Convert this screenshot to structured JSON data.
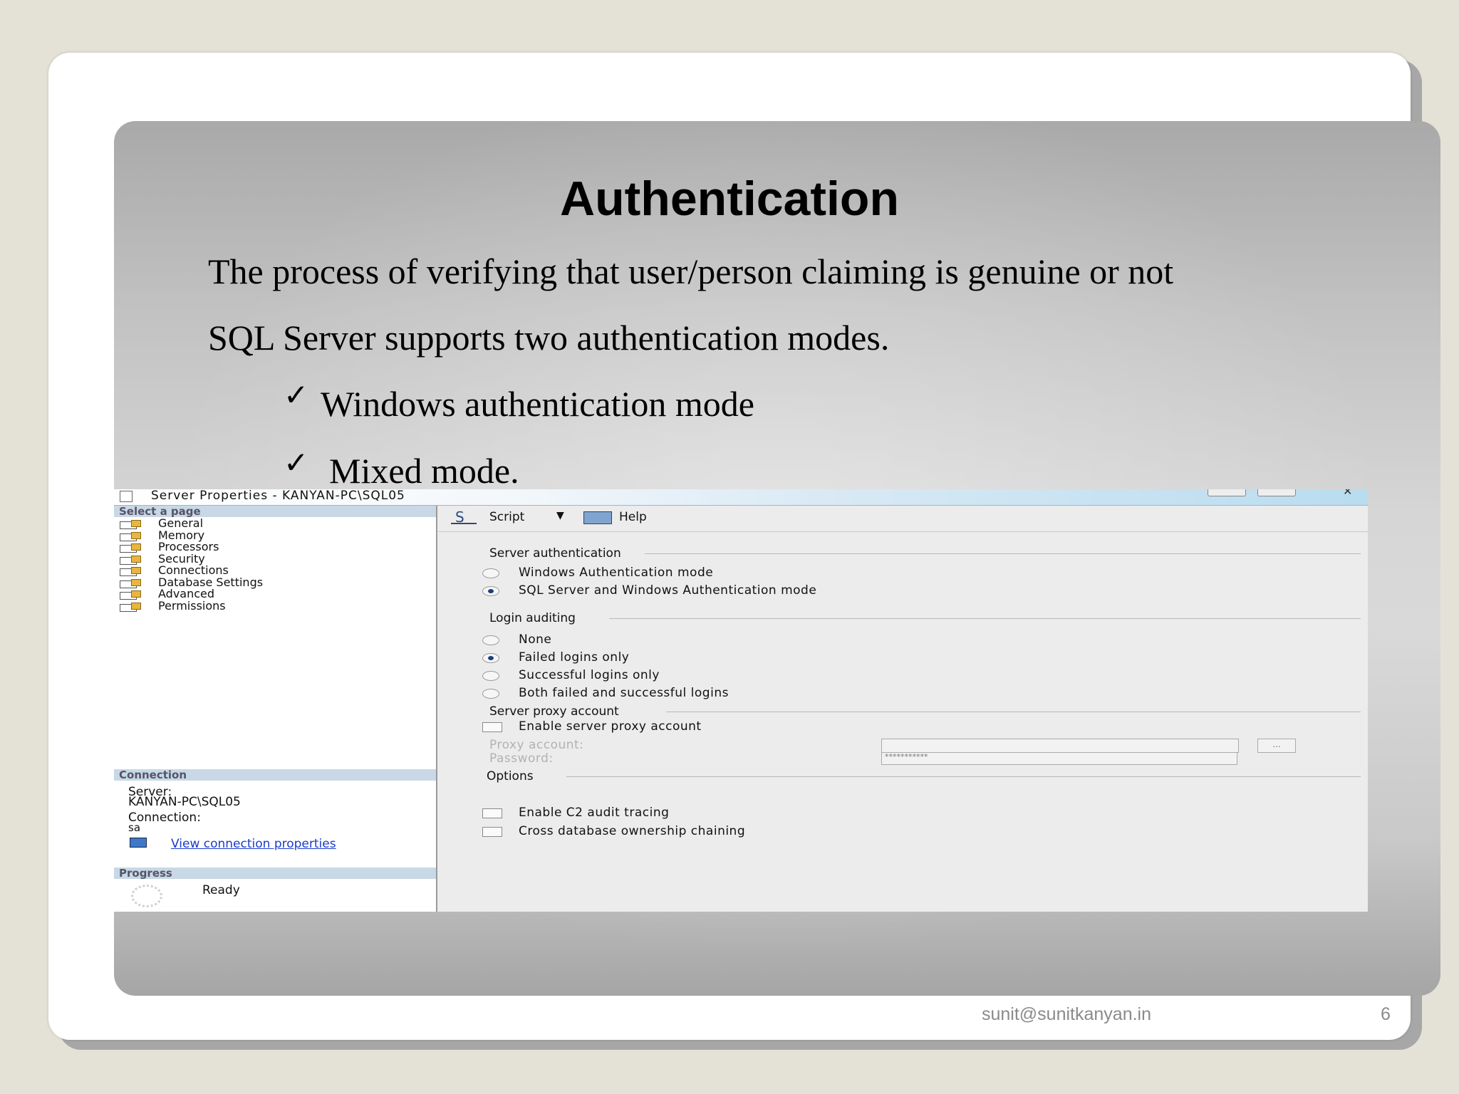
{
  "slide": {
    "title": "Authentication",
    "line1": "The process of verifying that user/person claiming is genuine or not",
    "line2": "SQL Server supports two authentication modes.",
    "bullets": [
      "Windows authentication mode",
      "Mixed mode."
    ],
    "check_glyph": "✓",
    "footer_email": "sunit@sunitkanyan.in",
    "page_number": "6"
  },
  "dialog": {
    "title": "Server Properties - KANYAN-PC\\SQL05",
    "select_page_header": "Select a page",
    "pages": [
      "General",
      "Memory",
      "Processors",
      "Security",
      "Connections",
      "Database Settings",
      "Advanced",
      "Permissions"
    ],
    "connection_header": "Connection",
    "server_label": "Server:",
    "server_value": "KANYAN-PC\\SQL05",
    "connection_label": "Connection:",
    "connection_value": "sa",
    "view_connection_link": "View connection properties",
    "progress_header": "Progress",
    "progress_status": "Ready",
    "toolbar": {
      "script_label": "Script",
      "help_label": "Help"
    },
    "server_auth": {
      "heading": "Server authentication",
      "options": [
        "Windows Authentication mode",
        "SQL Server and Windows Authentication mode"
      ],
      "selected": 1
    },
    "login_auditing": {
      "heading": "Login auditing",
      "options": [
        "None",
        "Failed logins only",
        "Successful logins only",
        "Both failed and successful logins"
      ],
      "selected": 1
    },
    "proxy": {
      "heading": "Server proxy account",
      "enable_label": "Enable server proxy account",
      "proxy_account_label": "Proxy account:",
      "password_label": "Password:",
      "password_value": "***********",
      "browse_label": "..."
    },
    "options": {
      "heading": "Options",
      "c2_label": "Enable C2 audit tracing",
      "cross_db_label": "Cross database ownership chaining"
    }
  }
}
